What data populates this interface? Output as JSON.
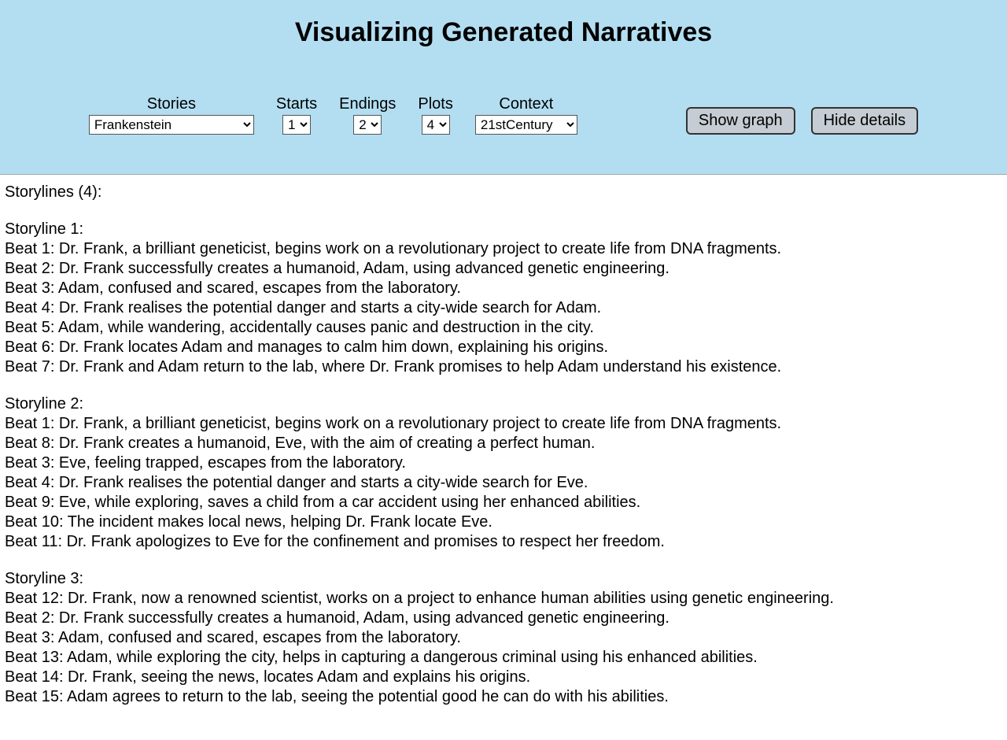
{
  "title": "Visualizing Generated Narratives",
  "controls": {
    "stories": {
      "label": "Stories",
      "value": "Frankenstein"
    },
    "starts": {
      "label": "Starts",
      "value": "1"
    },
    "endings": {
      "label": "Endings",
      "value": "2"
    },
    "plots": {
      "label": "Plots",
      "value": "4"
    },
    "context": {
      "label": "Context",
      "value": "21stCentury"
    }
  },
  "buttons": {
    "show_graph": "Show graph",
    "hide_details": "Hide details"
  },
  "storylines_header": "Storylines (4):",
  "storylines": [
    {
      "title": "Storyline 1:",
      "beats": [
        "Beat 1: Dr. Frank, a brilliant geneticist, begins work on a revolutionary project to create life from DNA fragments.",
        "Beat 2: Dr. Frank successfully creates a humanoid, Adam, using advanced genetic engineering.",
        "Beat 3: Adam, confused and scared, escapes from the laboratory.",
        "Beat 4: Dr. Frank realises the potential danger and starts a city-wide search for Adam.",
        "Beat 5: Adam, while wandering, accidentally causes panic and destruction in the city.",
        "Beat 6: Dr. Frank locates Adam and manages to calm him down, explaining his origins.",
        "Beat 7: Dr. Frank and Adam return to the lab, where Dr. Frank promises to help Adam understand his existence."
      ]
    },
    {
      "title": "Storyline 2:",
      "beats": [
        "Beat 1: Dr. Frank, a brilliant geneticist, begins work on a revolutionary project to create life from DNA fragments.",
        "Beat 8: Dr. Frank creates a humanoid, Eve, with the aim of creating a perfect human.",
        "Beat 3: Eve, feeling trapped, escapes from the laboratory.",
        "Beat 4: Dr. Frank realises the potential danger and starts a city-wide search for Eve.",
        "Beat 9: Eve, while exploring, saves a child from a car accident using her enhanced abilities.",
        "Beat 10: The incident makes local news, helping Dr. Frank locate Eve.",
        "Beat 11: Dr. Frank apologizes to Eve for the confinement and promises to respect her freedom."
      ]
    },
    {
      "title": "Storyline 3:",
      "beats": [
        "Beat 12: Dr. Frank, now a renowned scientist, works on a project to enhance human abilities using genetic engineering.",
        "Beat 2: Dr. Frank successfully creates a humanoid, Adam, using advanced genetic engineering.",
        "Beat 3: Adam, confused and scared, escapes from the laboratory.",
        "Beat 13: Adam, while exploring the city, helps in capturing a dangerous criminal using his enhanced abilities.",
        "Beat 14: Dr. Frank, seeing the news, locates Adam and explains his origins.",
        "Beat 15: Adam agrees to return to the lab, seeing the potential good he can do with his abilities."
      ]
    }
  ]
}
